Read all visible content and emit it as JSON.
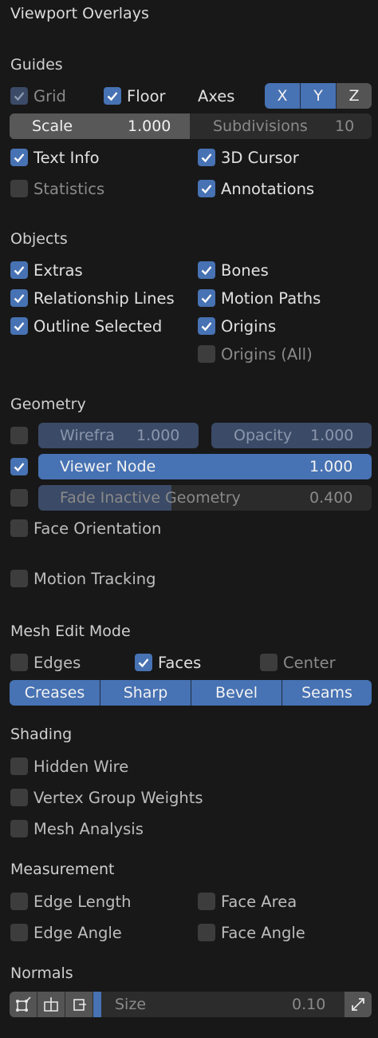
{
  "panel": {
    "title": "Viewport Overlays"
  },
  "colors": {
    "background": "#181818",
    "accent": "#4772b3",
    "checkbox_off": "#3d3d3d",
    "slider_bg": "#2c2c2c"
  },
  "guides": {
    "heading": "Guides",
    "grid": "Grid",
    "floor": "Floor",
    "axes": "Axes",
    "axis_x": "X",
    "axis_y": "Y",
    "axis_z": "Z",
    "scale_label": "Scale",
    "scale_value": "1.000",
    "subdivisions_label": "Subdivisions",
    "subdivisions_value": "10",
    "text_info": "Text Info",
    "cursor_3d": "3D Cursor",
    "statistics": "Statistics",
    "annotations": "Annotations"
  },
  "objects": {
    "heading": "Objects",
    "extras": "Extras",
    "bones": "Bones",
    "relationship_lines": "Relationship Lines",
    "motion_paths": "Motion Paths",
    "outline_selected": "Outline Selected",
    "origins": "Origins",
    "origins_all": "Origins (All)"
  },
  "geometry": {
    "heading": "Geometry",
    "wireframe_label": "Wirefra",
    "wireframe_value": "1.000",
    "opacity_label": "Opacity",
    "opacity_value": "1.000",
    "viewer_node_label": "Viewer Node",
    "viewer_node_value": "1.000",
    "fade_label": "Fade Inactive Geometry",
    "fade_value": "0.400",
    "fade_fraction": 0.4,
    "face_orientation": "Face Orientation",
    "motion_tracking": "Motion Tracking"
  },
  "mesh_edit": {
    "heading": "Mesh Edit Mode",
    "edges": "Edges",
    "faces": "Faces",
    "center": "Center",
    "creases": "Creases",
    "sharp": "Sharp",
    "bevel": "Bevel",
    "seams": "Seams"
  },
  "shading": {
    "heading": "Shading",
    "hidden_wire": "Hidden Wire",
    "vertex_group_weights": "Vertex Group Weights",
    "mesh_analysis": "Mesh Analysis"
  },
  "measurement": {
    "heading": "Measurement",
    "edge_length": "Edge Length",
    "face_area": "Face Area",
    "edge_angle": "Edge Angle",
    "face_angle": "Face Angle"
  },
  "normals": {
    "heading": "Normals",
    "size_label": "Size",
    "size_value": "0.10"
  }
}
